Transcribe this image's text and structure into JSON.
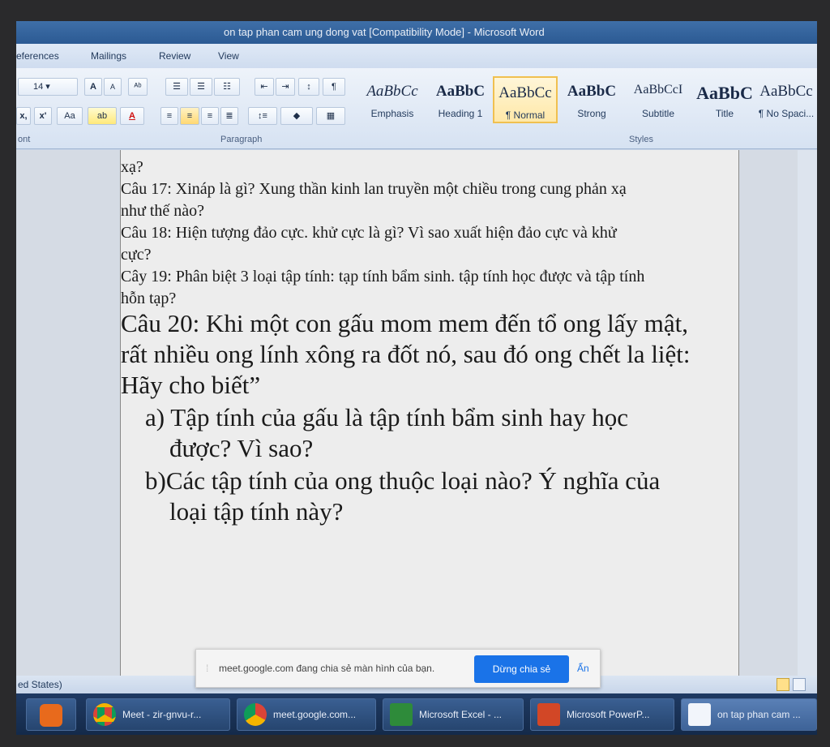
{
  "window": {
    "title": "on tap phan cam ung dong vat [Compatibility Mode] - Microsoft Word"
  },
  "ribbon_tabs": [
    "eferences",
    "Mailings",
    "Review",
    "View"
  ],
  "font_group": {
    "size": "14",
    "label": "ont",
    "buttons": [
      "A",
      "A",
      "Aa",
      "ab",
      "A",
      "x,",
      "x'"
    ]
  },
  "paragraph_group": {
    "label": "Paragraph"
  },
  "styles_group": {
    "label": "Styles",
    "items": [
      {
        "sample": "AaBbCc",
        "name": "Emphasis"
      },
      {
        "sample": "AaBbC",
        "name": "Heading 1"
      },
      {
        "sample": "AaBbCc",
        "name": "¶ Normal",
        "selected": true
      },
      {
        "sample": "AaBbC",
        "name": "Strong"
      },
      {
        "sample": "AaBbCcI",
        "name": "Subtitle"
      },
      {
        "sample": "AaBbC",
        "name": "Title"
      },
      {
        "sample": "AaBbCc",
        "name": "¶ No Spaci..."
      }
    ]
  },
  "document": {
    "lines_small": [
      "xạ?",
      "Câu 17: Xináp là gì? Xung thần kinh lan truyền một chiều trong cung phản xạ",
      "như thế nào?",
      "Câu 18: Hiện tượng đảo cực. khử cực là gì? Vì sao xuất hiện đảo cực và khử",
      "cực?",
      "Cây 19: Phân biệt 3 loại tập tính: tạp tính bẩm sinh. tập tính học được và tập tính",
      "hỗn tạp?"
    ],
    "lines_big": [
      "Câu 20: Khi một con gấu mom mem đến tổ ong lấy mật,",
      "rất nhiều ong lính xông ra đốt nó, sau đó ong chết la liệt:",
      "Hãy cho biết”",
      "a) Tập tính của gấu là tập tính bẩm sinh hay học",
      "được? Vì sao?",
      "b)Các tập tính của ong thuộc loại nào? Ý nghĩa của",
      "loại tập tính này?"
    ]
  },
  "share_notification": {
    "message": "meet.google.com đang chia sẻ màn hình của bạn.",
    "stop_label": "Dừng chia sẻ",
    "hide_label": "Ẩn"
  },
  "status_bar": {
    "language": "ed States)"
  },
  "taskbar": [
    {
      "label": "Meet - zir-gnvu-r...",
      "icon": "chrome-icon"
    },
    {
      "label": "meet.google.com...",
      "icon": "chrome-icon"
    },
    {
      "label": "Microsoft Excel - ...",
      "icon": "excel-icon"
    },
    {
      "label": "Microsoft PowerP...",
      "icon": "powerpoint-icon"
    },
    {
      "label": "on tap phan cam ...",
      "icon": "word-icon"
    }
  ],
  "colors": {
    "accent": "#1a73e8",
    "taskbar": "#1f3a63"
  }
}
